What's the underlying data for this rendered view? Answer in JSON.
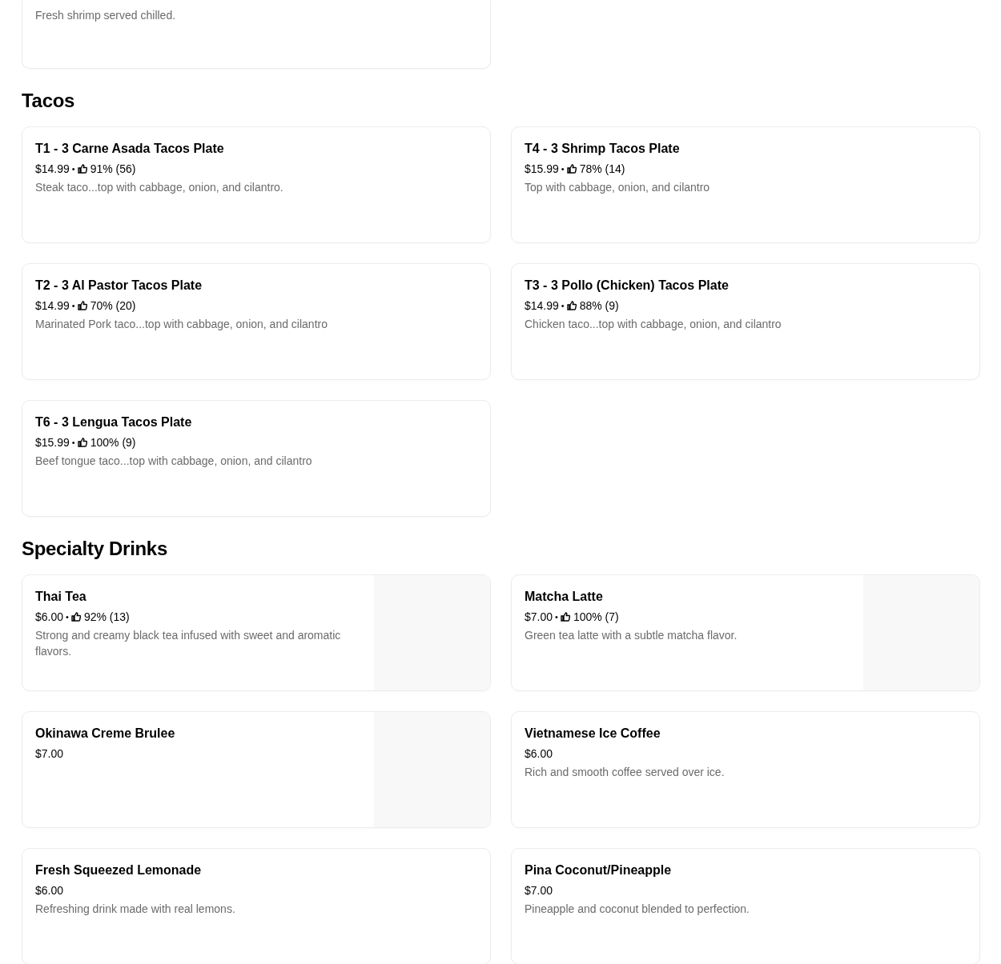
{
  "top_item": {
    "description": "Fresh shrimp served chilled."
  },
  "sections": [
    {
      "title": "Tacos",
      "items": [
        {
          "name": "T1 - 3 Carne Asada Tacos Plate",
          "price": "$14.99",
          "rating": {
            "separator": "•",
            "text": "91% (56)"
          },
          "description": "Steak taco...top with cabbage, onion, and cilantro."
        },
        {
          "name": "T4 - 3 Shrimp Tacos Plate",
          "price": "$15.99",
          "rating": {
            "separator": "•",
            "text": "78% (14)"
          },
          "description": "Top with cabbage, onion, and cilantro"
        },
        {
          "name": "T2 - 3 Al Pastor Tacos Plate",
          "price": "$14.99",
          "rating": {
            "separator": "•",
            "text": "70% (20)"
          },
          "description": "Marinated Pork taco...top with cabbage, onion, and cilantro"
        },
        {
          "name": "T3 - 3 Pollo (Chicken) Tacos Plate",
          "price": "$14.99",
          "rating": {
            "separator": "•",
            "text": "88% (9)"
          },
          "description": "Chicken taco...top with cabbage, onion, and cilantro"
        },
        {
          "name": "T6 - 3 Lengua Tacos Plate",
          "price": "$15.99",
          "rating": {
            "separator": "•",
            "text": "100% (9)"
          },
          "description": "Beef tongue taco...top with cabbage, onion, and cilantro"
        }
      ]
    },
    {
      "title": "Specialty Drinks",
      "items": [
        {
          "name": "Thai Tea",
          "price": "$6.00",
          "rating": {
            "separator": "•",
            "text": "92% (13)"
          },
          "description": "Strong and creamy black tea infused with sweet and aromatic flavors."
        },
        {
          "name": "Matcha Latte",
          "price": "$7.00",
          "rating": {
            "separator": "•",
            "text": "100% (7)"
          },
          "description": "Green tea latte with a subtle matcha flavor."
        },
        {
          "name": "Okinawa Creme Brulee",
          "price": "$7.00"
        },
        {
          "name": "Vietnamese Ice Coffee",
          "price": "$6.00",
          "description": "Rich and smooth coffee served over ice."
        },
        {
          "name": "Fresh Squeezed Lemonade",
          "price": "$6.00",
          "description": "Refreshing drink made with real lemons."
        },
        {
          "name": "Pina Coconut/Pineapple",
          "price": "$7.00",
          "description": "Pineapple and coconut blended to perfection."
        }
      ]
    }
  ]
}
